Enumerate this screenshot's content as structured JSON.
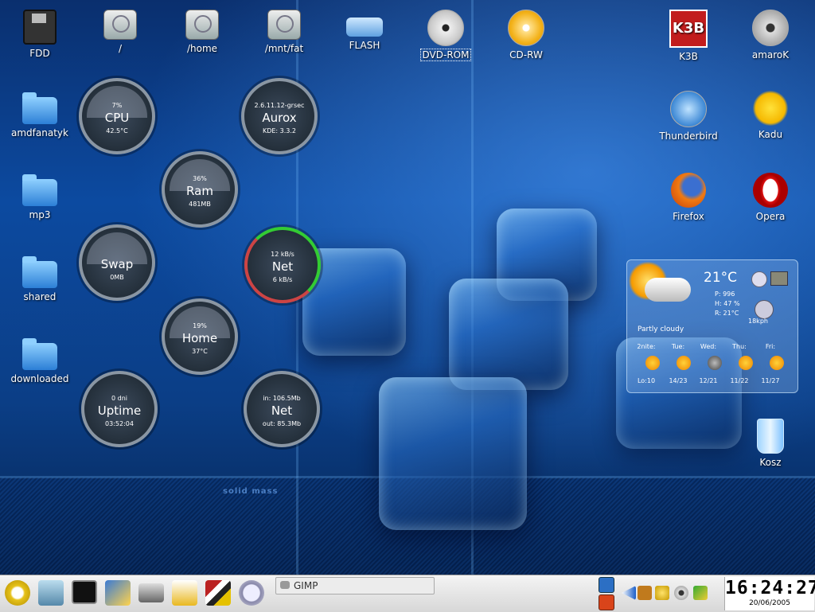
{
  "desktop_icons": [
    {
      "label": "FDD",
      "icon": "floppy-disk-icon"
    },
    {
      "label": "/",
      "icon": "hard-disk-icon"
    },
    {
      "label": "/home",
      "icon": "hard-disk-icon"
    },
    {
      "label": "/mnt/fat",
      "icon": "hard-disk-icon"
    },
    {
      "label": "FLASH",
      "icon": "usb-flash-icon"
    },
    {
      "label": "DVD-ROM",
      "icon": "dvd-icon",
      "selected": true
    },
    {
      "label": "CD-RW",
      "icon": "cd-icon"
    },
    {
      "label": "K3B",
      "icon": "k3b-icon"
    },
    {
      "label": "amaroK",
      "icon": "amarok-icon"
    },
    {
      "label": "amdfanatyk",
      "icon": "folder-link-icon"
    },
    {
      "label": "mp3",
      "icon": "folder-link-icon"
    },
    {
      "label": "shared",
      "icon": "folder-link-icon"
    },
    {
      "label": "downloaded",
      "icon": "folder-icon"
    },
    {
      "label": "Thunderbird",
      "icon": "thunderbird-icon"
    },
    {
      "label": "Kadu",
      "icon": "kadu-sun-icon"
    },
    {
      "label": "Firefox",
      "icon": "firefox-icon"
    },
    {
      "label": "Opera",
      "icon": "opera-icon"
    },
    {
      "label": "Kosz",
      "icon": "trash-icon"
    }
  ],
  "gauges": {
    "cpu": {
      "top": "7%",
      "title": "CPU",
      "bottom": "42.5°C"
    },
    "aurox": {
      "top": "2.6.11.12-grsec",
      "title": "Aurox",
      "bottom": "KDE: 3.3.2"
    },
    "ram": {
      "top": "36%",
      "title": "Ram",
      "bottom": "481MB"
    },
    "swap": {
      "top": "",
      "title": "Swap",
      "bottom": "0MB"
    },
    "net1": {
      "top": "12 kB/s",
      "title": "Net",
      "bottom": "6 kB/s"
    },
    "home": {
      "top": "19%",
      "title": "Home",
      "bottom": "37°C"
    },
    "uptime": {
      "top": "0 dni",
      "title": "Uptime",
      "bottom": "03:52:04"
    },
    "net2": {
      "top": "in: 106.5Mb",
      "title": "Net",
      "bottom": "out: 85.3Mb"
    }
  },
  "weather": {
    "temp": "21°C",
    "pressure": "P:   996",
    "humidity": "H:   47 %",
    "realfeel": "R:   21°C",
    "wind": "18kph",
    "condition": "Partly cloudy",
    "days": [
      {
        "name": "2nite:",
        "temps": "Lo:10"
      },
      {
        "name": "Tue:",
        "temps": "14/23"
      },
      {
        "name": "Wed:",
        "temps": "12/21"
      },
      {
        "name": "Thu:",
        "temps": "11/22"
      },
      {
        "name": "Fri:",
        "temps": "11/27"
      }
    ]
  },
  "wallpaper_text": "solid mass",
  "taskbar": {
    "task_label": "GIMP",
    "clock_time": "16:24:27",
    "clock_date": "20/06/2005"
  },
  "colors": {
    "accent": "#0c4aa0",
    "taskbar": "#e4e4e4"
  }
}
